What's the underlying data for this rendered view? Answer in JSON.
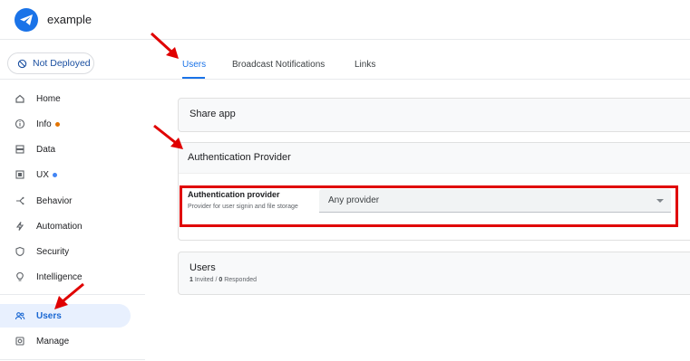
{
  "app": {
    "name": "example"
  },
  "sidebar": {
    "deploy_status": "Not Deployed",
    "items": [
      {
        "label": "Home",
        "icon": "home-icon"
      },
      {
        "label": "Info",
        "icon": "info-icon",
        "dot": "#e37400"
      },
      {
        "label": "Data",
        "icon": "data-icon"
      },
      {
        "label": "UX",
        "icon": "ux-icon",
        "dot": "#4285f4"
      },
      {
        "label": "Behavior",
        "icon": "behavior-icon"
      },
      {
        "label": "Automation",
        "icon": "automation-icon"
      },
      {
        "label": "Security",
        "icon": "security-icon"
      },
      {
        "label": "Intelligence",
        "icon": "lightbulb-icon"
      },
      {
        "label": "Users",
        "icon": "users-icon",
        "active": true
      },
      {
        "label": "Manage",
        "icon": "manage-icon"
      }
    ]
  },
  "tabs": [
    {
      "label": "Users",
      "active": true
    },
    {
      "label": "Broadcast Notifications"
    },
    {
      "label": "Links"
    }
  ],
  "share_app": {
    "title": "Share app"
  },
  "auth_provider": {
    "title": "Authentication Provider",
    "field_label": "Authentication provider",
    "field_help": "Provider for user signin and file storage",
    "selected": "Any provider"
  },
  "users": {
    "title": "Users",
    "invited": "1",
    "invited_label": "Invited",
    "separator": "/",
    "responded": "0",
    "responded_label": "Responded"
  },
  "colors": {
    "accent": "#1a73e8",
    "annotation": "#e00000"
  }
}
